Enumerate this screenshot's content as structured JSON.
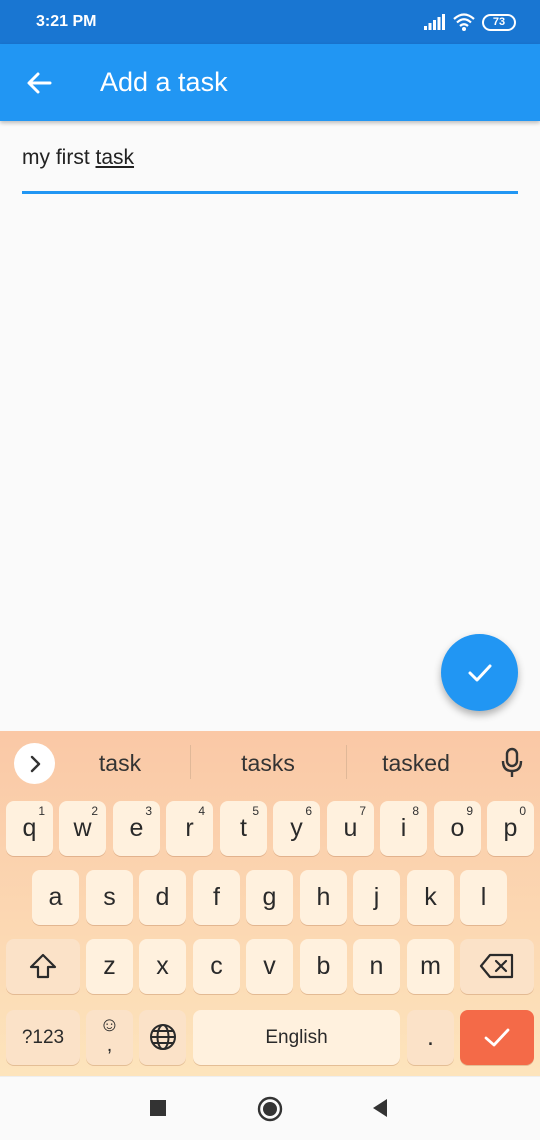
{
  "status_bar": {
    "time": "3:21 PM",
    "battery": "73"
  },
  "app_bar": {
    "title": "Add a task"
  },
  "task_field": {
    "value_plain": "my first ",
    "value_underlined": "task"
  },
  "keyboard": {
    "suggestions": [
      "task",
      "tasks",
      "tasked"
    ],
    "row1": [
      {
        "key": "q",
        "num": "1"
      },
      {
        "key": "w",
        "num": "2"
      },
      {
        "key": "e",
        "num": "3"
      },
      {
        "key": "r",
        "num": "4"
      },
      {
        "key": "t",
        "num": "5"
      },
      {
        "key": "y",
        "num": "6"
      },
      {
        "key": "u",
        "num": "7"
      },
      {
        "key": "i",
        "num": "8"
      },
      {
        "key": "o",
        "num": "9"
      },
      {
        "key": "p",
        "num": "0"
      }
    ],
    "row2": [
      "a",
      "s",
      "d",
      "f",
      "g",
      "h",
      "j",
      "k",
      "l"
    ],
    "row3": [
      "z",
      "x",
      "c",
      "v",
      "b",
      "n",
      "m"
    ],
    "symbols_label": "?123",
    "emoji_label": "☺",
    "comma_label": ",",
    "space_label": "English",
    "period_label": "."
  },
  "colors": {
    "app_bar": "#2196f3",
    "status_bar": "#1976d2",
    "accent": "#2196f3",
    "enter_key": "#f46a48"
  }
}
